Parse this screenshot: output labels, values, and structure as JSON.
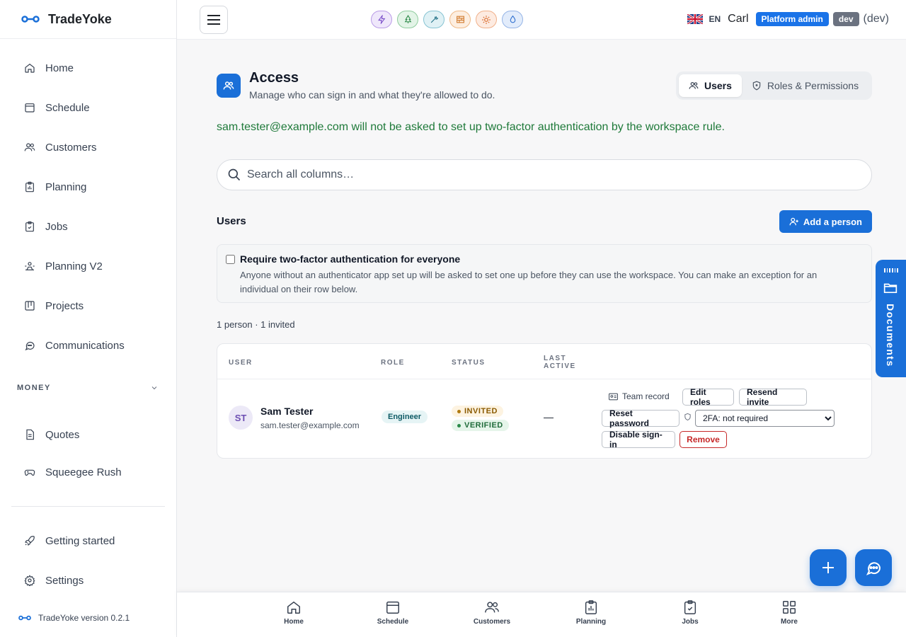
{
  "brand": {
    "name": "TradeYoke",
    "version_text": "TradeYoke version 0.2.1"
  },
  "sidebar": {
    "items": [
      {
        "label": "Home",
        "icon": "home-icon"
      },
      {
        "label": "Schedule",
        "icon": "calendar-icon"
      },
      {
        "label": "Customers",
        "icon": "users-icon"
      },
      {
        "label": "Planning",
        "icon": "clipboard-chart-icon"
      },
      {
        "label": "Jobs",
        "icon": "clipboard-check-icon"
      },
      {
        "label": "Planning V2",
        "icon": "planning-v2-icon"
      },
      {
        "label": "Projects",
        "icon": "kanban-icon"
      },
      {
        "label": "Communications",
        "icon": "chat-icon"
      }
    ],
    "money_section": {
      "label": "MONEY",
      "items": [
        {
          "label": "Quotes",
          "icon": "document-icon"
        },
        {
          "label": "Squeegee Rush",
          "icon": "gamepad-icon"
        }
      ]
    },
    "footer_items": [
      {
        "label": "Getting started",
        "icon": "rocket-icon"
      },
      {
        "label": "Settings",
        "icon": "gear-icon"
      }
    ]
  },
  "topbar": {
    "lang": "EN",
    "user": "Carl",
    "role_badge": "Platform admin",
    "env_badge": "dev",
    "env_text": "(dev)"
  },
  "page": {
    "title": "Access",
    "subtitle": "Manage who can sign in and what they're allowed to do.",
    "tabs": [
      {
        "label": "Users",
        "active": true
      },
      {
        "label": "Roles & Permissions",
        "active": false
      }
    ],
    "notice": "sam.tester@example.com will not be asked to set up two-factor authentication by the workspace rule.",
    "search_placeholder": "Search all columns…",
    "users_heading": "Users",
    "add_button": "Add a person",
    "twofa": {
      "title": "Require two-factor authentication for everyone",
      "checked": false,
      "description": "Anyone without an authenticator app set up will be asked to set one up before they can use the workspace. You can make an exception for an individual on their row below."
    },
    "count_text": "1 person · 1 invited"
  },
  "table": {
    "headers": {
      "user": "USER",
      "role": "ROLE",
      "status": "STATUS",
      "last_active_1": "LAST",
      "last_active_2": "ACTIVE"
    },
    "rows": [
      {
        "initials": "ST",
        "name": "Sam Tester",
        "email": "sam.tester@example.com",
        "role": "Engineer",
        "status_1": "INVITED",
        "status_2": "VERIFIED",
        "last_active": "—",
        "actions": {
          "team_record": "Team record",
          "edit_roles": "Edit roles",
          "resend_invite": "Resend invite",
          "reset_password": "Reset password",
          "twofa_select": "2FA: not required",
          "disable_signin": "Disable sign-in",
          "remove": "Remove"
        }
      }
    ]
  },
  "documents_tab": {
    "label": "Documents"
  },
  "bottom_nav": [
    {
      "label": "Home"
    },
    {
      "label": "Schedule"
    },
    {
      "label": "Customers"
    },
    {
      "label": "Planning"
    },
    {
      "label": "Jobs"
    },
    {
      "label": "More"
    }
  ],
  "colors": {
    "primary": "#1a6fd8",
    "success_text": "#1f7a3a",
    "danger": "#c62828"
  }
}
